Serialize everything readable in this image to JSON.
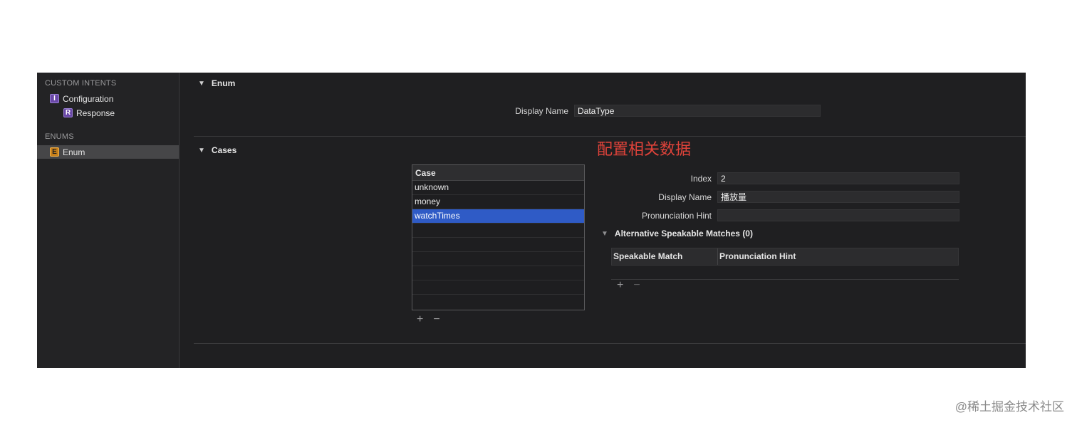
{
  "sidebar": {
    "sections": [
      {
        "title": "CUSTOM INTENTS",
        "items": [
          {
            "badge": "I",
            "label": "Configuration"
          },
          {
            "badge": "R",
            "label": "Response"
          }
        ]
      },
      {
        "title": "ENUMS",
        "items": [
          {
            "badge": "E",
            "label": "Enum",
            "selected": true
          }
        ]
      }
    ]
  },
  "enum_section": {
    "title": "Enum",
    "display_name_label": "Display Name",
    "display_name_value": "DataType"
  },
  "cases_section": {
    "title": "Cases",
    "annotation": "配置相关数据",
    "table": {
      "header": "Case",
      "rows": [
        "unknown",
        "money",
        "watchTimes"
      ],
      "selected_index": 2
    },
    "add_symbol": "+",
    "remove_symbol": "−",
    "detail": {
      "index_label": "Index",
      "index_value": "2",
      "display_name_label": "Display Name",
      "display_name_value": "播放量",
      "pronunciation_label": "Pronunciation Hint",
      "pronunciation_value": "",
      "alt_title": "Alternative Speakable Matches (0)",
      "alt_columns": [
        "Speakable Match",
        "Pronunciation Hint"
      ]
    }
  },
  "colors": {
    "accent": "#2f5bc6",
    "annotation": "#e0433a",
    "background": "#1f1f21"
  },
  "watermark": "@稀土掘金技术社区"
}
